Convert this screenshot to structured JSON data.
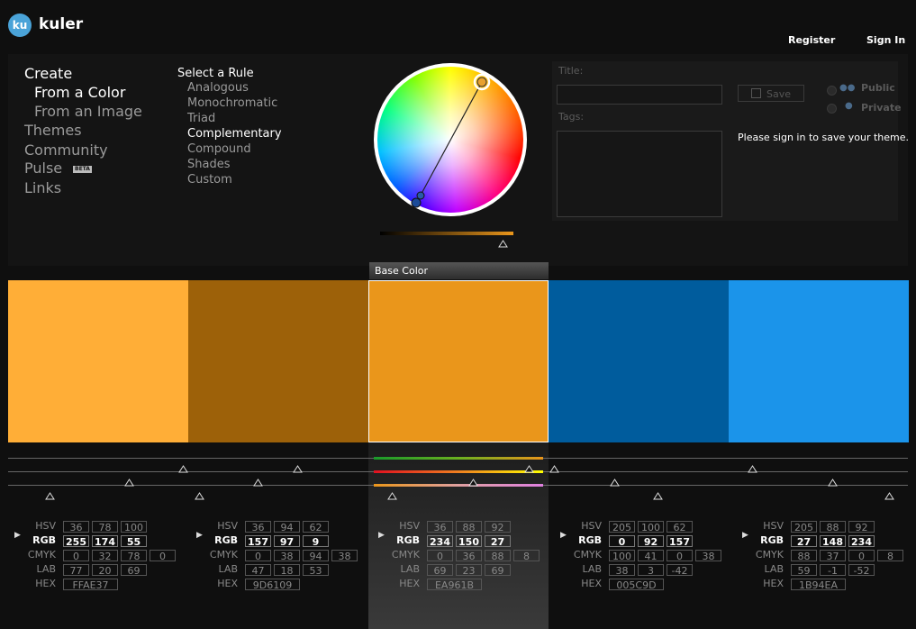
{
  "app": {
    "logo_badge": "ku",
    "name": "kuler"
  },
  "header": {
    "register": "Register",
    "sign_in": "Sign In"
  },
  "nav": {
    "create": "Create",
    "from_color": "From a Color",
    "from_image": "From an Image",
    "themes": "Themes",
    "community": "Community",
    "pulse": "Pulse",
    "beta": "BETA",
    "links": "Links"
  },
  "rules": {
    "heading": "Select a Rule",
    "items": [
      "Analogous",
      "Monochromatic",
      "Triad",
      "Complementary",
      "Compound",
      "Shades",
      "Custom"
    ],
    "selected": "Complementary"
  },
  "form": {
    "title_label": "Title:",
    "tags_label": "Tags:",
    "save": "Save",
    "public": "Public",
    "private": "Private",
    "message": "Please sign in to save your theme."
  },
  "base_label": "Base Color",
  "row_labels": {
    "hsv": "HSV",
    "rgb": "RGB",
    "cmyk": "CMYK",
    "lab": "LAB",
    "hex": "HEX"
  },
  "swatches": [
    {
      "color": "#FFAE37",
      "hsv": [
        "36",
        "78",
        "100"
      ],
      "rgb": [
        "255",
        "174",
        "55"
      ],
      "cmyk": [
        "0",
        "32",
        "78",
        "0"
      ],
      "lab": [
        "77",
        "20",
        "69"
      ],
      "hex": "FFAE37"
    },
    {
      "color": "#9D6109",
      "hsv": [
        "36",
        "94",
        "62"
      ],
      "rgb": [
        "157",
        "97",
        "9"
      ],
      "cmyk": [
        "0",
        "38",
        "94",
        "38"
      ],
      "lab": [
        "47",
        "18",
        "53"
      ],
      "hex": "9D6109"
    },
    {
      "color": "#EA961B",
      "hsv": [
        "36",
        "88",
        "92"
      ],
      "rgb": [
        "234",
        "150",
        "27"
      ],
      "cmyk": [
        "0",
        "36",
        "88",
        "8"
      ],
      "lab": [
        "69",
        "23",
        "69"
      ],
      "hex": "EA961B"
    },
    {
      "color": "#005C9D",
      "hsv": [
        "205",
        "100",
        "62"
      ],
      "rgb": [
        "0",
        "92",
        "157"
      ],
      "cmyk": [
        "100",
        "41",
        "0",
        "38"
      ],
      "lab": [
        "38",
        "3",
        "-42"
      ],
      "hex": "005C9D"
    },
    {
      "color": "#1B94EA",
      "hsv": [
        "205",
        "88",
        "92"
      ],
      "rgb": [
        "27",
        "148",
        "234"
      ],
      "cmyk": [
        "88",
        "37",
        "0",
        "8"
      ],
      "lab": [
        "59",
        "-1",
        "-52"
      ],
      "hex": "1B94EA"
    }
  ],
  "icons": {
    "play": "▶",
    "triangle": "△"
  }
}
